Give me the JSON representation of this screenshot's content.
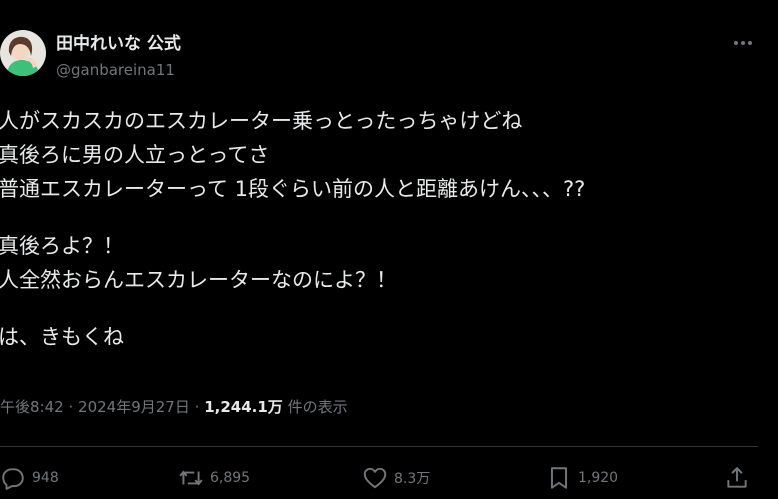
{
  "author": {
    "display_name": "田中れいな 公式",
    "handle": "@ganbareina11"
  },
  "body_lines": [
    "人がスカスカのエスカレーター乗っとったっちゃけどね",
    "真後ろに男の人立っとってさ",
    "普通エスカレーターって 1段ぐらい前の人と距離あけん、、、??",
    "",
    "真後ろよ？！",
    "人全然おらんエスカレーターなのによ？！",
    "",
    "は、きもくね"
  ],
  "meta": {
    "time": "午後8:42",
    "separator": "·",
    "date": "2024年9月27日",
    "views_count": "1,244.1万",
    "views_label": "件の表示"
  },
  "actions": {
    "reply_count": "948",
    "repost_count": "6,895",
    "like_count": "8.3万",
    "bookmark_count": "1,920"
  },
  "icons": {
    "more": "more-horizontal-icon",
    "reply": "reply-icon",
    "repost": "repost-icon",
    "like": "heart-icon",
    "bookmark": "bookmark-icon",
    "share": "share-icon"
  },
  "colors": {
    "background": "#000000",
    "text_primary": "#e7e9ea",
    "text_secondary": "#71767b",
    "divider": "#2f3336"
  }
}
